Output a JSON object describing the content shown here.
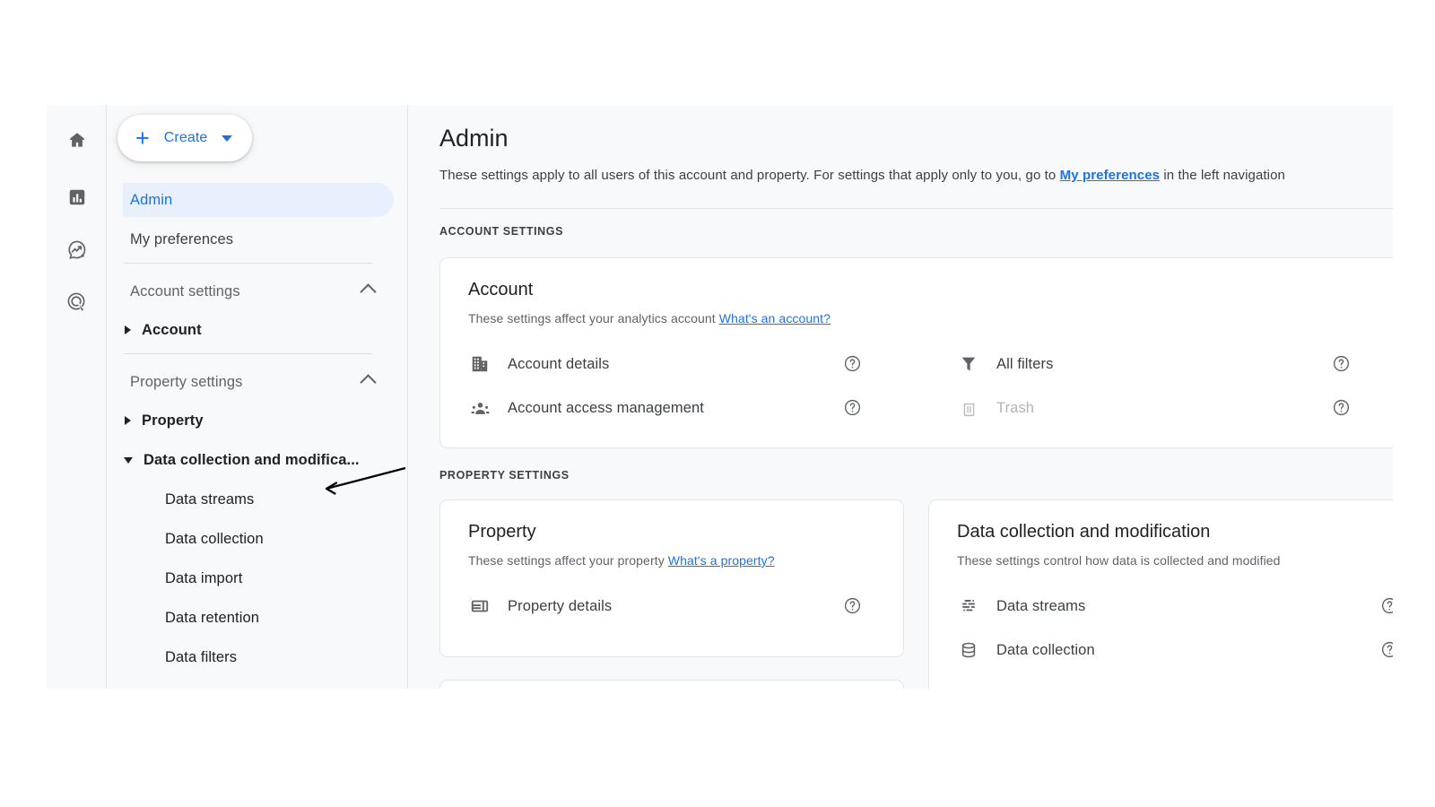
{
  "rail": {
    "items": [
      {
        "name": "home-icon",
        "label": "Home"
      },
      {
        "name": "reports-icon",
        "label": "Reports"
      },
      {
        "name": "explore-icon",
        "label": "Explore"
      },
      {
        "name": "advertising-icon",
        "label": "Advertising"
      }
    ]
  },
  "sidebar": {
    "create_button": {
      "label": "Create",
      "plus": "+",
      "caret": "▾"
    },
    "items": [
      {
        "label": "Admin",
        "type": "link",
        "selected": true
      },
      {
        "label": "My preferences",
        "type": "link",
        "selected": false
      },
      {
        "label": "Account settings",
        "type": "group",
        "expanded": true
      },
      {
        "label": "Account",
        "type": "child",
        "expanded": false
      },
      {
        "label": "Property settings",
        "type": "group",
        "expanded": true
      },
      {
        "label": "Property",
        "type": "child",
        "expanded": false
      },
      {
        "label": "Data collection and modifica...",
        "type": "child",
        "expanded": true
      },
      {
        "label": "Data streams",
        "type": "leaf"
      },
      {
        "label": "Data collection",
        "type": "leaf"
      },
      {
        "label": "Data import",
        "type": "leaf"
      },
      {
        "label": "Data retention",
        "type": "leaf"
      },
      {
        "label": "Data filters",
        "type": "leaf"
      }
    ]
  },
  "main": {
    "title": "Admin",
    "description_before": "These settings apply to all users of this account and property. For settings that apply only to you, go to ",
    "description_link": "My preferences",
    "description_after": " in the left navigation",
    "account_section_label": "ACCOUNT SETTINGS",
    "property_section_label": "PROPERTY SETTINGS",
    "account_card": {
      "title": "Account",
      "subtitle": "These settings affect your analytics account ",
      "subtitle_link": "What's an account?",
      "left_items": [
        {
          "label": "Account details",
          "icon": "building-icon",
          "disabled": false
        },
        {
          "label": "Account access management",
          "icon": "people-icon",
          "disabled": false
        }
      ],
      "right_items": [
        {
          "label": "All filters",
          "icon": "filter-icon",
          "disabled": false
        },
        {
          "label": "Trash",
          "icon": "trash-icon",
          "disabled": true
        }
      ]
    },
    "property_card": {
      "title": "Property",
      "subtitle": "These settings affect your property ",
      "subtitle_link": "What's a property?",
      "items": [
        {
          "label": "Property details",
          "icon": "property-details-icon",
          "disabled": false
        }
      ]
    },
    "data_collection_card": {
      "title": "Data collection and modification",
      "subtitle": "These settings control how data is collected and modified",
      "items": [
        {
          "label": "Data streams",
          "icon": "data-streams-icon",
          "disabled": false
        },
        {
          "label": "Data collection",
          "icon": "database-icon",
          "disabled": false
        }
      ]
    },
    "help_icon": "help-circle-icon"
  },
  "colors": {
    "accent": "#1a73e8",
    "selected_bg": "#e8effd",
    "page_bg": "#f8f9fa",
    "card_bg": "#ffffff",
    "border": "#e3e5e8",
    "text_primary": "#202124",
    "text_secondary": "#5f6368",
    "disabled": "#b0b3b7",
    "icon": "#5f6368"
  }
}
